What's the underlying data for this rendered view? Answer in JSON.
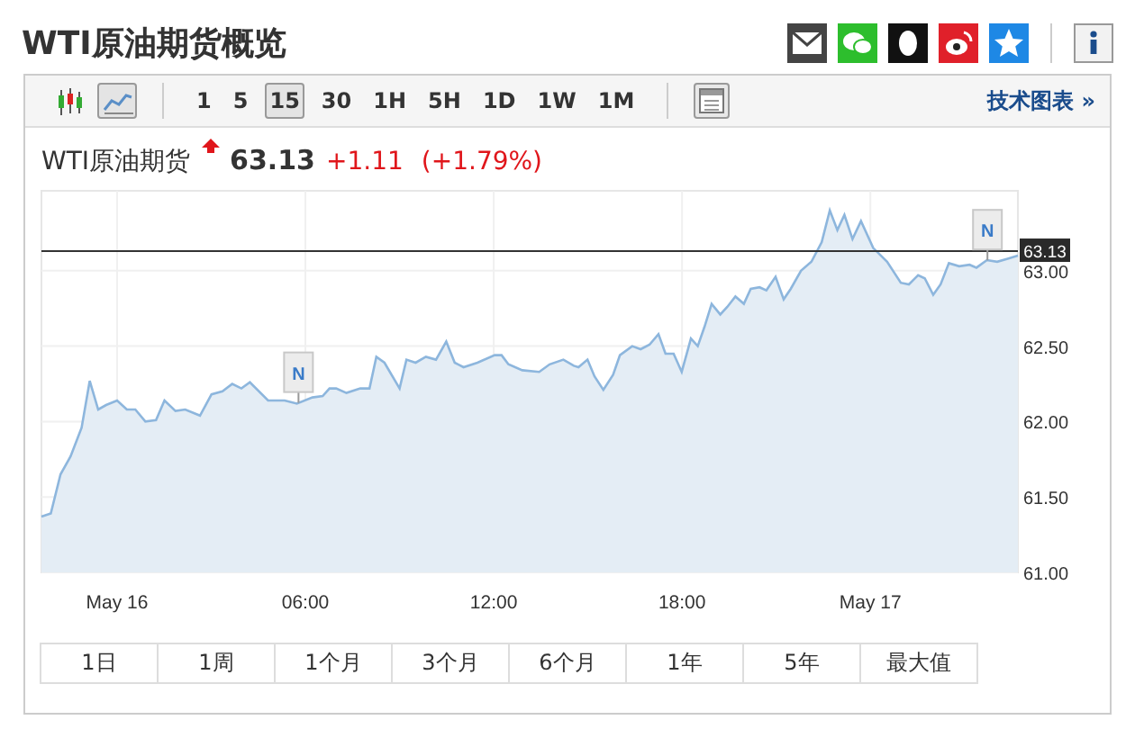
{
  "page": {
    "title": "WTI原油期货概览"
  },
  "share_icons": [
    {
      "kind": "mail"
    },
    {
      "kind": "wechat"
    },
    {
      "kind": "qq"
    },
    {
      "kind": "weibo"
    },
    {
      "kind": "qzone"
    },
    {
      "kind": "info"
    }
  ],
  "toolbar": {
    "chart_types": [
      {
        "kind": "candlestick",
        "selected": false
      },
      {
        "kind": "line",
        "selected": true
      }
    ],
    "intervals": [
      {
        "label": "1",
        "selected": false
      },
      {
        "label": "5",
        "selected": false
      },
      {
        "label": "15",
        "selected": true
      },
      {
        "label": "30",
        "selected": false
      },
      {
        "label": "1H",
        "selected": false
      },
      {
        "label": "5H",
        "selected": false
      },
      {
        "label": "1D",
        "selected": false
      },
      {
        "label": "1W",
        "selected": false
      },
      {
        "label": "1M",
        "selected": false
      }
    ],
    "link": "技术图表 »"
  },
  "quote": {
    "name": "WTI原油期货",
    "up": true,
    "price": "63.13",
    "change": "+1.11",
    "change_percent": "(+1.79%)"
  },
  "chart_data": {
    "type": "area",
    "grid": true,
    "xlim": [
      -2.41,
      28.7
    ],
    "ylim": [
      61.0,
      63.53
    ],
    "xticks": [
      {
        "value": 0,
        "label": "May 16"
      },
      {
        "value": 6,
        "label": "06:00"
      },
      {
        "value": 12,
        "label": "12:00"
      },
      {
        "value": 18,
        "label": "18:00"
      },
      {
        "value": 24,
        "label": "May 17"
      }
    ],
    "yticks": [
      {
        "value": 61,
        "label": "61.00"
      },
      {
        "value": 61.5,
        "label": "61.50"
      },
      {
        "value": 62,
        "label": "62.00"
      },
      {
        "value": 62.5,
        "label": "62.50"
      },
      {
        "value": 63,
        "label": "63.00"
      }
    ],
    "x": [
      -2.41,
      -2.11,
      -1.8,
      -1.48,
      -1.13,
      -0.87,
      -0.6,
      -0.35,
      0,
      0.31,
      0.58,
      0.9,
      1.24,
      1.51,
      1.86,
      2.17,
      2.64,
      3.01,
      3.36,
      3.67,
      3.96,
      4.23,
      4.81,
      5.34,
      5.73,
      6.22,
      6.55,
      6.77,
      6.98,
      7.31,
      7.75,
      8.04,
      8.26,
      8.52,
      9.0,
      9.22,
      9.51,
      9.84,
      10.16,
      10.49,
      10.76,
      11.04,
      11.48,
      12.03,
      12.25,
      12.47,
      12.91,
      13.45,
      13.78,
      14.22,
      14.55,
      14.7,
      14.99,
      15.21,
      15.49,
      15.8,
      16.02,
      16.41,
      16.68,
      16.96,
      17.25,
      17.47,
      17.73,
      17.99,
      18.28,
      18.5,
      18.72,
      18.94,
      19.22,
      19.44,
      19.7,
      19.97,
      20.19,
      20.47,
      20.69,
      20.98,
      21.24,
      21.46,
      21.79,
      22.12,
      22.45,
      22.71,
      22.95,
      23.17,
      23.43,
      23.7,
      24.09,
      24.53,
      24.97,
      25.23,
      25.52,
      25.73,
      26.0,
      26.24,
      26.5,
      26.83,
      27.16,
      27.38,
      27.71,
      28.04,
      28.37,
      28.7
    ],
    "series": [
      {
        "color": "#8db6dd",
        "values": [
          61.37,
          61.39,
          61.65,
          61.77,
          61.96,
          62.27,
          62.08,
          62.11,
          62.14,
          62.08,
          62.08,
          62.0,
          62.01,
          62.14,
          62.07,
          62.08,
          62.04,
          62.18,
          62.2,
          62.25,
          62.22,
          62.26,
          62.14,
          62.14,
          62.12,
          62.16,
          62.17,
          62.22,
          62.22,
          62.19,
          62.22,
          62.22,
          62.43,
          62.39,
          62.22,
          62.41,
          62.39,
          62.43,
          62.41,
          62.53,
          62.39,
          62.36,
          62.39,
          62.44,
          62.44,
          62.38,
          62.34,
          62.33,
          62.38,
          62.41,
          62.37,
          62.36,
          62.41,
          62.3,
          62.21,
          62.31,
          62.44,
          62.5,
          62.48,
          62.51,
          62.58,
          62.45,
          62.45,
          62.33,
          62.55,
          62.5,
          62.63,
          62.78,
          62.71,
          62.76,
          62.83,
          62.78,
          62.88,
          62.89,
          62.87,
          62.96,
          62.81,
          62.88,
          63.0,
          63.06,
          63.19,
          63.4,
          63.27,
          63.37,
          63.21,
          63.33,
          63.15,
          63.06,
          62.92,
          62.91,
          62.97,
          62.95,
          62.84,
          62.91,
          63.05,
          63.03,
          63.04,
          63.02,
          63.07,
          63.06,
          63.08,
          63.1
        ]
      }
    ],
    "ref_lines": [
      {
        "axis": "y",
        "value": 63.13,
        "label": "63.13"
      }
    ],
    "annotations": [
      {
        "x": 5.78,
        "text": "N"
      },
      {
        "x": 27.73,
        "text": "N"
      }
    ]
  },
  "ranges": [
    {
      "label": "1日",
      "selected": false
    },
    {
      "label": "1周",
      "selected": false
    },
    {
      "label": "1个月",
      "selected": false
    },
    {
      "label": "3个月",
      "selected": false
    },
    {
      "label": "6个月",
      "selected": false
    },
    {
      "label": "1年",
      "selected": false
    },
    {
      "label": "5年",
      "selected": false
    },
    {
      "label": "最大值",
      "selected": false
    }
  ]
}
